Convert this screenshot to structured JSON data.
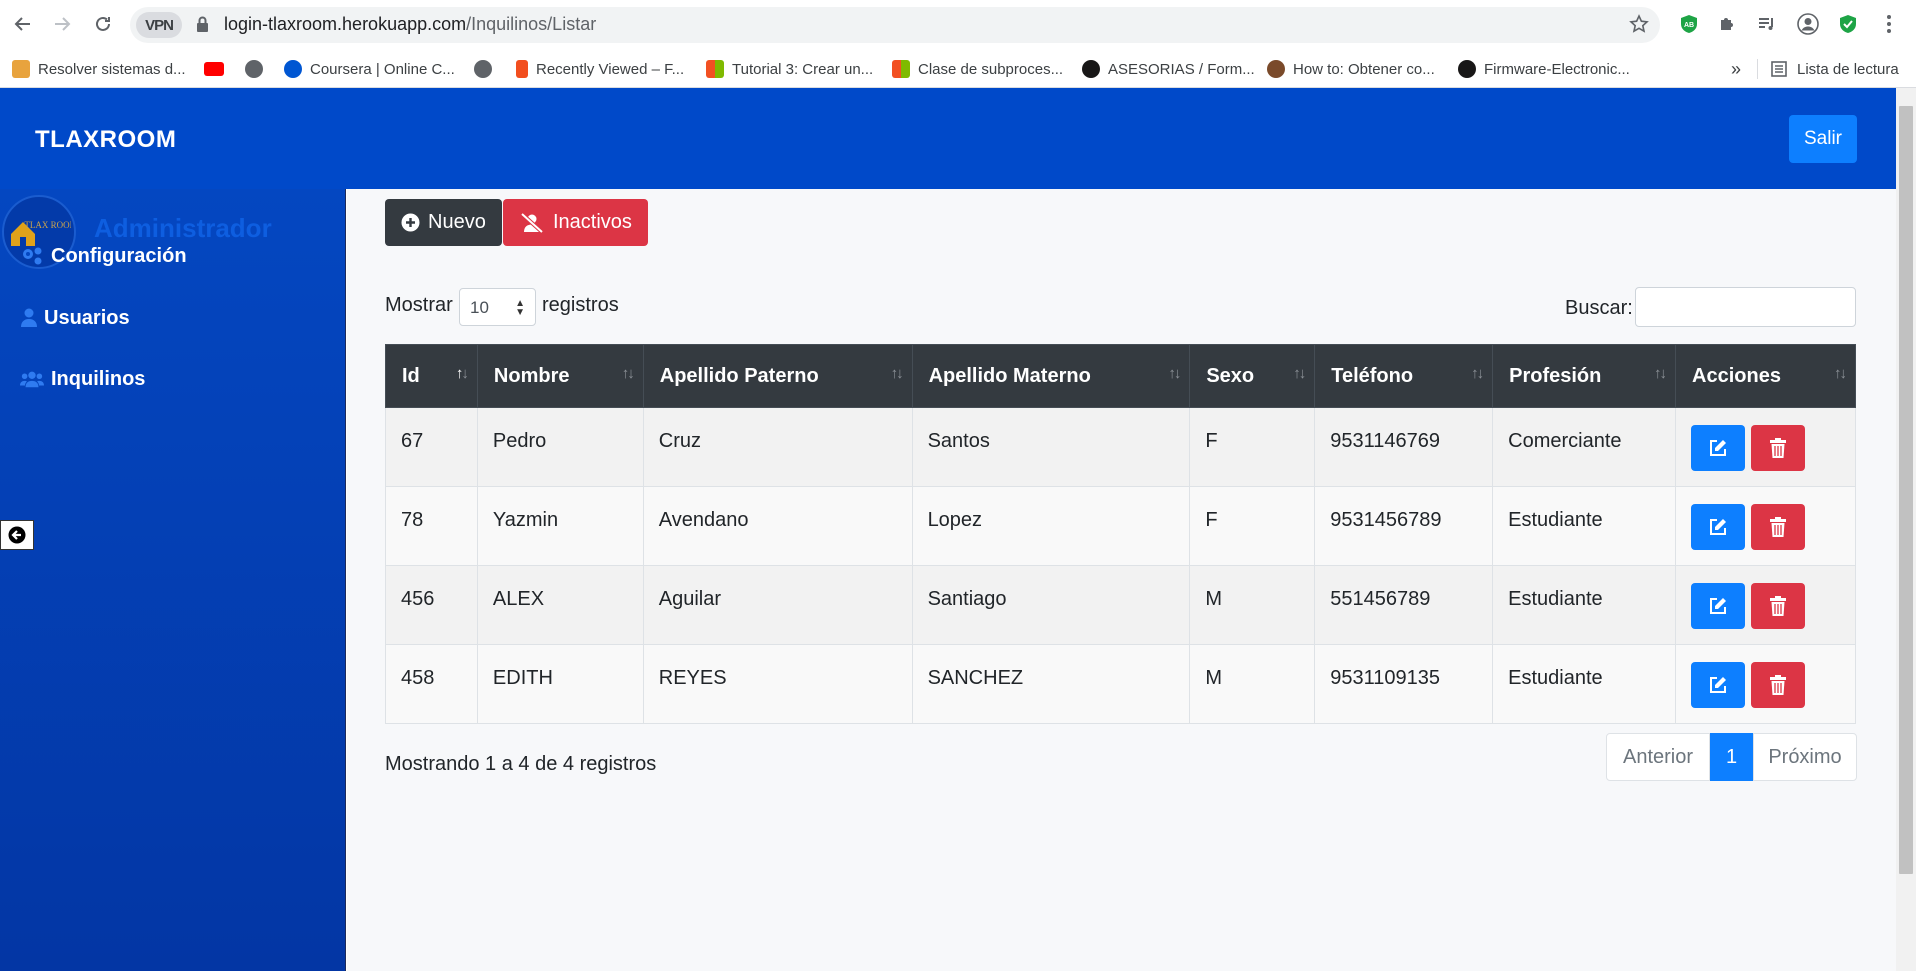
{
  "browser": {
    "url_host": "login-tlaxroom.herokuapp.com",
    "url_path": "/Inquilinos/Listar",
    "vpn_label": "VPN",
    "bookmarks": [
      {
        "label": "Resolver sistemas d...",
        "color": "#e8a33d"
      },
      {
        "label": "",
        "color": "#ff0000"
      },
      {
        "label": "",
        "color": "#5f6368"
      },
      {
        "label": "Coursera | Online C...",
        "color": "#0056d2"
      },
      {
        "label": "",
        "color": "#5f6368"
      },
      {
        "label": "Recently Viewed – F...",
        "color": "#f24e1e"
      },
      {
        "label": "Tutorial 3: Crear un...",
        "color": "#f25022"
      },
      {
        "label": "Clase de subproces...",
        "color": "#f25022"
      },
      {
        "label": "ASESORIAS / Form...",
        "color": "#181717"
      },
      {
        "label": "How to: Obtener co...",
        "color": "#7a4a2a"
      },
      {
        "label": "Firmware-Electronic...",
        "color": "#181717"
      }
    ],
    "more_bookmarks": "»",
    "reading_list": "Lista de lectura"
  },
  "header": {
    "brand": "TLAXROOM",
    "logout_label": "Salir"
  },
  "sidebar": {
    "title": "Administrador",
    "avatar_text": "TLAX ROOM",
    "items": [
      {
        "label": "Configuración",
        "icon": "gears-icon"
      },
      {
        "label": "Usuarios",
        "icon": "user-icon"
      },
      {
        "label": "Inquilinos",
        "icon": "users-icon"
      }
    ]
  },
  "toolbar": {
    "new_label": "Nuevo",
    "inactive_label": "Inactivos"
  },
  "table_controls": {
    "show_label": "Mostrar",
    "page_size": "10",
    "records_label": "registros",
    "search_label": "Buscar:",
    "search_value": ""
  },
  "table": {
    "columns": [
      "Id",
      "Nombre",
      "Apellido Paterno",
      "Apellido Materno",
      "Sexo",
      "Teléfono",
      "Profesión",
      "Acciones"
    ],
    "rows": [
      {
        "id": "67",
        "nombre": "Pedro",
        "paterno": "Cruz",
        "materno": "Santos",
        "sexo": "F",
        "telefono": "9531146769",
        "profesion": "Comerciante"
      },
      {
        "id": "78",
        "nombre": "Yazmin",
        "paterno": "Avendano",
        "materno": "Lopez",
        "sexo": "F",
        "telefono": "9531456789",
        "profesion": "Estudiante"
      },
      {
        "id": "456",
        "nombre": "ALEX",
        "paterno": "Aguilar",
        "materno": "Santiago",
        "sexo": "M",
        "telefono": "551456789",
        "profesion": "Estudiante"
      },
      {
        "id": "458",
        "nombre": "EDITH",
        "paterno": "REYES",
        "materno": "SANCHEZ",
        "sexo": "M",
        "telefono": "9531109135",
        "profesion": "Estudiante"
      }
    ]
  },
  "footer": {
    "info": "Mostrando 1 a 4 de 4 registros",
    "prev_label": "Anterior",
    "current_page": "1",
    "next_label": "Próximo"
  },
  "colors": {
    "header_bg": "#0049c9",
    "primary": "#0d7fff",
    "danger": "#dc3545",
    "dark": "#343a40"
  }
}
